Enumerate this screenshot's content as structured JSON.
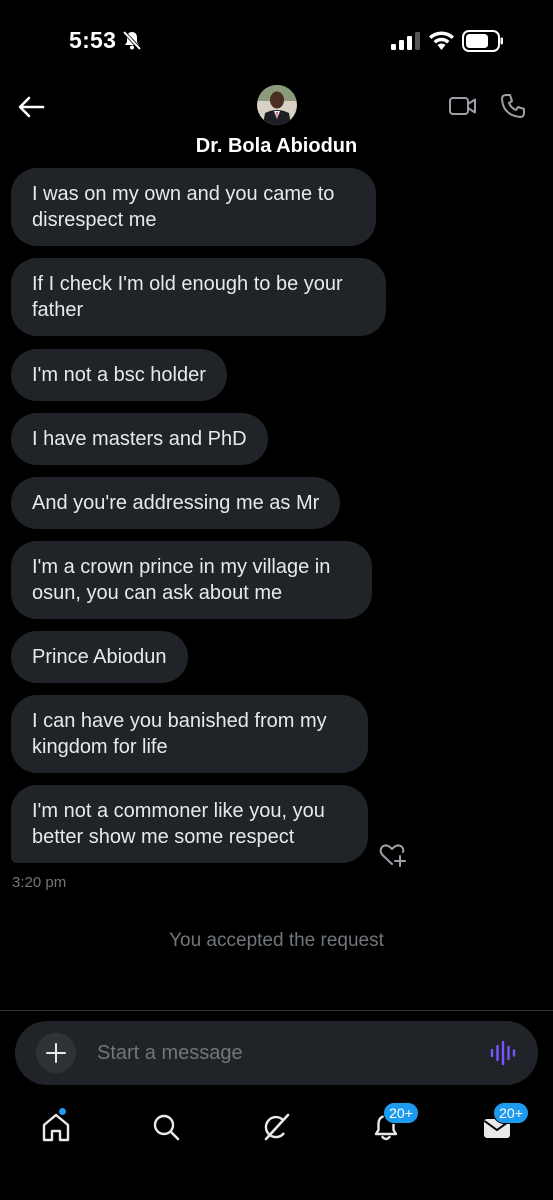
{
  "status_bar": {
    "time": "5:53"
  },
  "header": {
    "contact_name": "Dr. Bola Abiodun",
    "icons": [
      "back-arrow-icon",
      "video-camera-icon",
      "phone-icon"
    ]
  },
  "messages": [
    {
      "lines": [
        "I was on my own and you came to",
        "disrespect me"
      ]
    },
    {
      "lines": [
        "If I check I'm old enough to be your",
        "father"
      ]
    },
    {
      "lines": [
        "I'm not a bsc holder"
      ]
    },
    {
      "lines": [
        "I have masters and PhD"
      ]
    },
    {
      "lines": [
        "And you're addressing me as Mr"
      ]
    },
    {
      "lines": [
        "I'm a crown prince in my village in",
        "osun, you can ask about me"
      ]
    },
    {
      "lines": [
        "Prince Abiodun"
      ]
    },
    {
      "lines": [
        "I can have you banished from my",
        "kingdom for life"
      ]
    },
    {
      "lines": [
        "I'm not a commoner like you, you",
        "better show me some respect"
      ]
    }
  ],
  "last_message_time": "3:20 pm",
  "system_notice": "You accepted the request",
  "composer": {
    "placeholder": "Start a message"
  },
  "bottom_nav": {
    "items": [
      "home-icon",
      "search-icon",
      "grok-icon",
      "notifications-icon",
      "messages-icon"
    ],
    "notifications_badge": "20+",
    "messages_badge": "20+"
  },
  "colors": {
    "background": "#000000",
    "bubble": "#202327",
    "text": "#e7e9ea",
    "muted": "#71767b",
    "accent": "#1d9bf0",
    "voice": "#7856ff"
  }
}
